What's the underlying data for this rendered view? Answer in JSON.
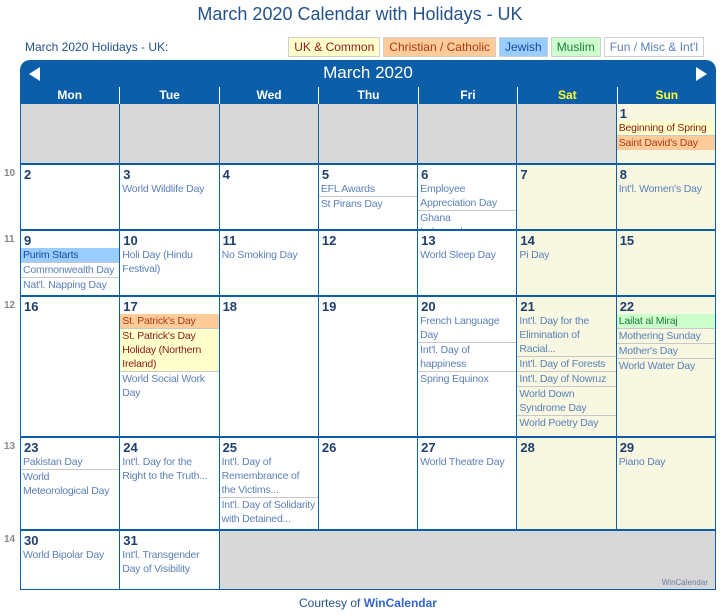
{
  "page": {
    "title": "March 2020 Calendar with Holidays - UK",
    "subtitle": "March 2020 Holidays - UK:",
    "courtesy_prefix": "Courtesy of ",
    "courtesy_brand": "WinCalendar"
  },
  "legend": [
    {
      "label": "UK & Common",
      "category": "uk"
    },
    {
      "label": "Christian / Catholic",
      "category": "ch"
    },
    {
      "label": "Jewish",
      "category": "jw"
    },
    {
      "label": "Muslim",
      "category": "mu"
    },
    {
      "label": "Fun / Misc & Int'l",
      "category": "fun"
    }
  ],
  "calendar": {
    "month_title": "March 2020",
    "prev_icon": "triangle-left",
    "next_icon": "triangle-right",
    "day_names": [
      "Mon",
      "Tue",
      "Wed",
      "Thu",
      "Fri",
      "Sat",
      "Sun"
    ],
    "weekend_color": "#ffff33",
    "watermark": "WinCalendar",
    "weeks": [
      {
        "week_no": "",
        "days": [
          null,
          null,
          null,
          null,
          null,
          null,
          {
            "day": "1",
            "weekend": true,
            "events": [
              {
                "text": "Beginning of Spring",
                "category": "uk"
              },
              {
                "text": "Saint David's Day",
                "category": "ch"
              }
            ]
          }
        ]
      },
      {
        "week_no": "10",
        "days": [
          {
            "day": "2",
            "events": []
          },
          {
            "day": "3",
            "events": [
              {
                "text": "World Wildlife Day",
                "category": "fun"
              }
            ]
          },
          {
            "day": "4",
            "events": []
          },
          {
            "day": "5",
            "events": [
              {
                "text": "EFL Awards",
                "category": "fun"
              },
              {
                "text": "St Pirans Day",
                "category": "fun"
              }
            ]
          },
          {
            "day": "6",
            "events": [
              {
                "text": "Employee Appreciation Day",
                "category": "fun"
              },
              {
                "text": "Ghana Independence",
                "category": "fun"
              }
            ]
          },
          {
            "day": "7",
            "weekend": true,
            "events": []
          },
          {
            "day": "8",
            "weekend": true,
            "events": [
              {
                "text": "Int'l. Women's Day",
                "category": "fun"
              }
            ]
          }
        ]
      },
      {
        "week_no": "11",
        "days": [
          {
            "day": "9",
            "events": [
              {
                "text": "Purim Starts",
                "category": "jw"
              },
              {
                "text": "Commonwealth Day",
                "category": "fun"
              },
              {
                "text": "Nat'l. Napping Day",
                "category": "fun"
              }
            ]
          },
          {
            "day": "10",
            "events": [
              {
                "text": "Holi Day (Hindu Festival)",
                "category": "fun"
              }
            ]
          },
          {
            "day": "11",
            "events": [
              {
                "text": "No Smoking Day",
                "category": "fun"
              }
            ]
          },
          {
            "day": "12",
            "events": []
          },
          {
            "day": "13",
            "events": [
              {
                "text": "World Sleep Day",
                "category": "fun"
              }
            ]
          },
          {
            "day": "14",
            "weekend": true,
            "events": [
              {
                "text": "Pi Day",
                "category": "fun"
              }
            ]
          },
          {
            "day": "15",
            "weekend": true,
            "events": []
          }
        ]
      },
      {
        "week_no": "12",
        "days": [
          {
            "day": "16",
            "events": []
          },
          {
            "day": "17",
            "events": [
              {
                "text": "St. Patrick's Day",
                "category": "ch"
              },
              {
                "text": "St. Patrick's Day Holiday (Northern Ireland)",
                "category": "uk"
              },
              {
                "text": "World Social Work Day",
                "category": "fun"
              }
            ]
          },
          {
            "day": "18",
            "events": []
          },
          {
            "day": "19",
            "events": []
          },
          {
            "day": "20",
            "events": [
              {
                "text": "French Language Day",
                "category": "fun"
              },
              {
                "text": "Int'l. Day of happiness",
                "category": "fun"
              },
              {
                "text": "Spring Equinox",
                "category": "fun"
              }
            ]
          },
          {
            "day": "21",
            "weekend": true,
            "events": [
              {
                "text": "Int'l. Day for the Elimination of Racial...",
                "category": "fun"
              },
              {
                "text": "Int'l. Day of Forests",
                "category": "fun"
              },
              {
                "text": "Int'l. Day of Nowruz",
                "category": "fun"
              },
              {
                "text": "World Down Syndrome Day",
                "category": "fun"
              },
              {
                "text": "World Poetry Day",
                "category": "fun"
              }
            ]
          },
          {
            "day": "22",
            "weekend": true,
            "events": [
              {
                "text": "Lailat al Miraj",
                "category": "mu"
              },
              {
                "text": "Mothering Sunday",
                "category": "fun"
              },
              {
                "text": "Mother's Day",
                "category": "fun"
              },
              {
                "text": "World Water Day",
                "category": "fun"
              }
            ]
          }
        ]
      },
      {
        "week_no": "13",
        "days": [
          {
            "day": "23",
            "events": [
              {
                "text": "Pakistan Day",
                "category": "fun"
              },
              {
                "text": "World Meteorological Day",
                "category": "fun"
              }
            ]
          },
          {
            "day": "24",
            "events": [
              {
                "text": "Int'l. Day for the Right to the Truth...",
                "category": "fun"
              }
            ]
          },
          {
            "day": "25",
            "events": [
              {
                "text": "Int'l. Day of Remembrance of the Victims...",
                "category": "fun"
              },
              {
                "text": "Int'l. Day of Solidarity with Detained...",
                "category": "fun"
              }
            ]
          },
          {
            "day": "26",
            "events": []
          },
          {
            "day": "27",
            "events": [
              {
                "text": "World Theatre Day",
                "category": "fun"
              }
            ]
          },
          {
            "day": "28",
            "weekend": true,
            "events": []
          },
          {
            "day": "29",
            "weekend": true,
            "events": [
              {
                "text": "Piano Day",
                "category": "fun"
              }
            ]
          }
        ]
      },
      {
        "week_no": "14",
        "days": [
          {
            "day": "30",
            "events": [
              {
                "text": "World Bipolar Day",
                "category": "fun"
              }
            ]
          },
          {
            "day": "31",
            "events": [
              {
                "text": "Int'l. Transgender Day of Visibility",
                "category": "fun"
              }
            ]
          },
          null,
          null,
          null,
          null,
          null
        ]
      }
    ]
  }
}
